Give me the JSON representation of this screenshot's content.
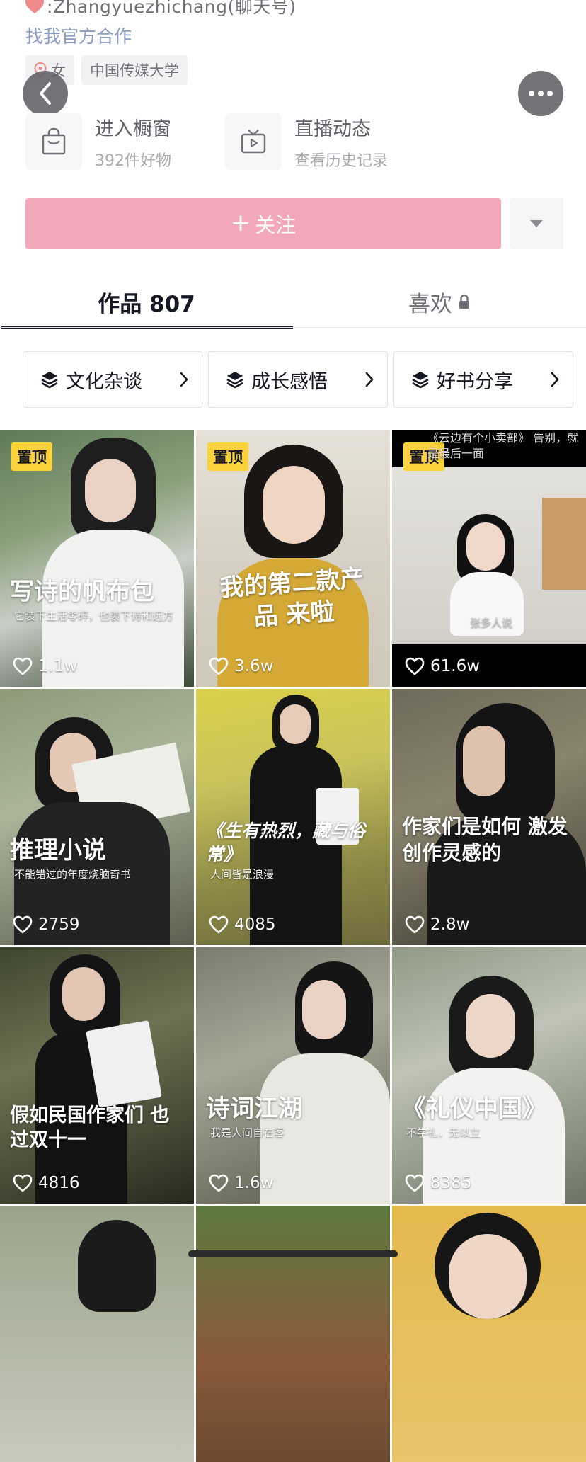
{
  "profile": {
    "wechat_line": ":Zhangyuezhichang(聊天号)",
    "collab_link": "找我官方合作",
    "tags": [
      "女",
      "中国传媒大学"
    ]
  },
  "entries": [
    {
      "title": "进入橱窗",
      "subtitle": "392件好物",
      "icon": "shopping-bag-icon"
    },
    {
      "title": "直播动态",
      "subtitle": "查看历史记录",
      "icon": "tv-icon"
    }
  ],
  "follow": {
    "label": "关注"
  },
  "tabs": [
    {
      "label": "作品 807"
    },
    {
      "label": "喜欢"
    }
  ],
  "collections": [
    {
      "label": "文化杂谈"
    },
    {
      "label": "成长感悟"
    },
    {
      "label": "好书分享"
    }
  ],
  "videos": [
    {
      "pinned": "置顶",
      "title": "写诗的帆布包",
      "subtitle": "它装下生活零碎，也装下诗和远方",
      "likes": "1.1w"
    },
    {
      "pinned": "置顶",
      "title": "我的第二款产品 来啦",
      "subtitle": "",
      "likes": "3.6w"
    },
    {
      "pinned": "置顶",
      "title": "《云边有个小卖部》 告别，就是最后一面",
      "subtitle": "张多人说",
      "likes": "61.6w"
    },
    {
      "pinned": "",
      "title": "推理小说",
      "subtitle": "不能错过的年度烧脑奇书",
      "likes": "2759"
    },
    {
      "pinned": "",
      "title": "《生有热烈，藏与俗常》",
      "subtitle": "人间皆是浪漫",
      "likes": "4085"
    },
    {
      "pinned": "",
      "title": "作家们是如何 激发创作灵感的",
      "subtitle": "",
      "likes": "2.8w"
    },
    {
      "pinned": "",
      "title": "假如民国作家们 也过双十一",
      "subtitle": "",
      "likes": "4816"
    },
    {
      "pinned": "",
      "title": "诗词江湖",
      "subtitle": "我是人间自在客",
      "likes": "1.6w"
    },
    {
      "pinned": "",
      "title": "《礼仪中国》",
      "subtitle": "不学礼，无以立",
      "likes": "8385"
    }
  ],
  "colors": {
    "follow_button": "#f2a8b8",
    "pinned_badge": "#fad23c",
    "link": "#8a9cc4"
  }
}
